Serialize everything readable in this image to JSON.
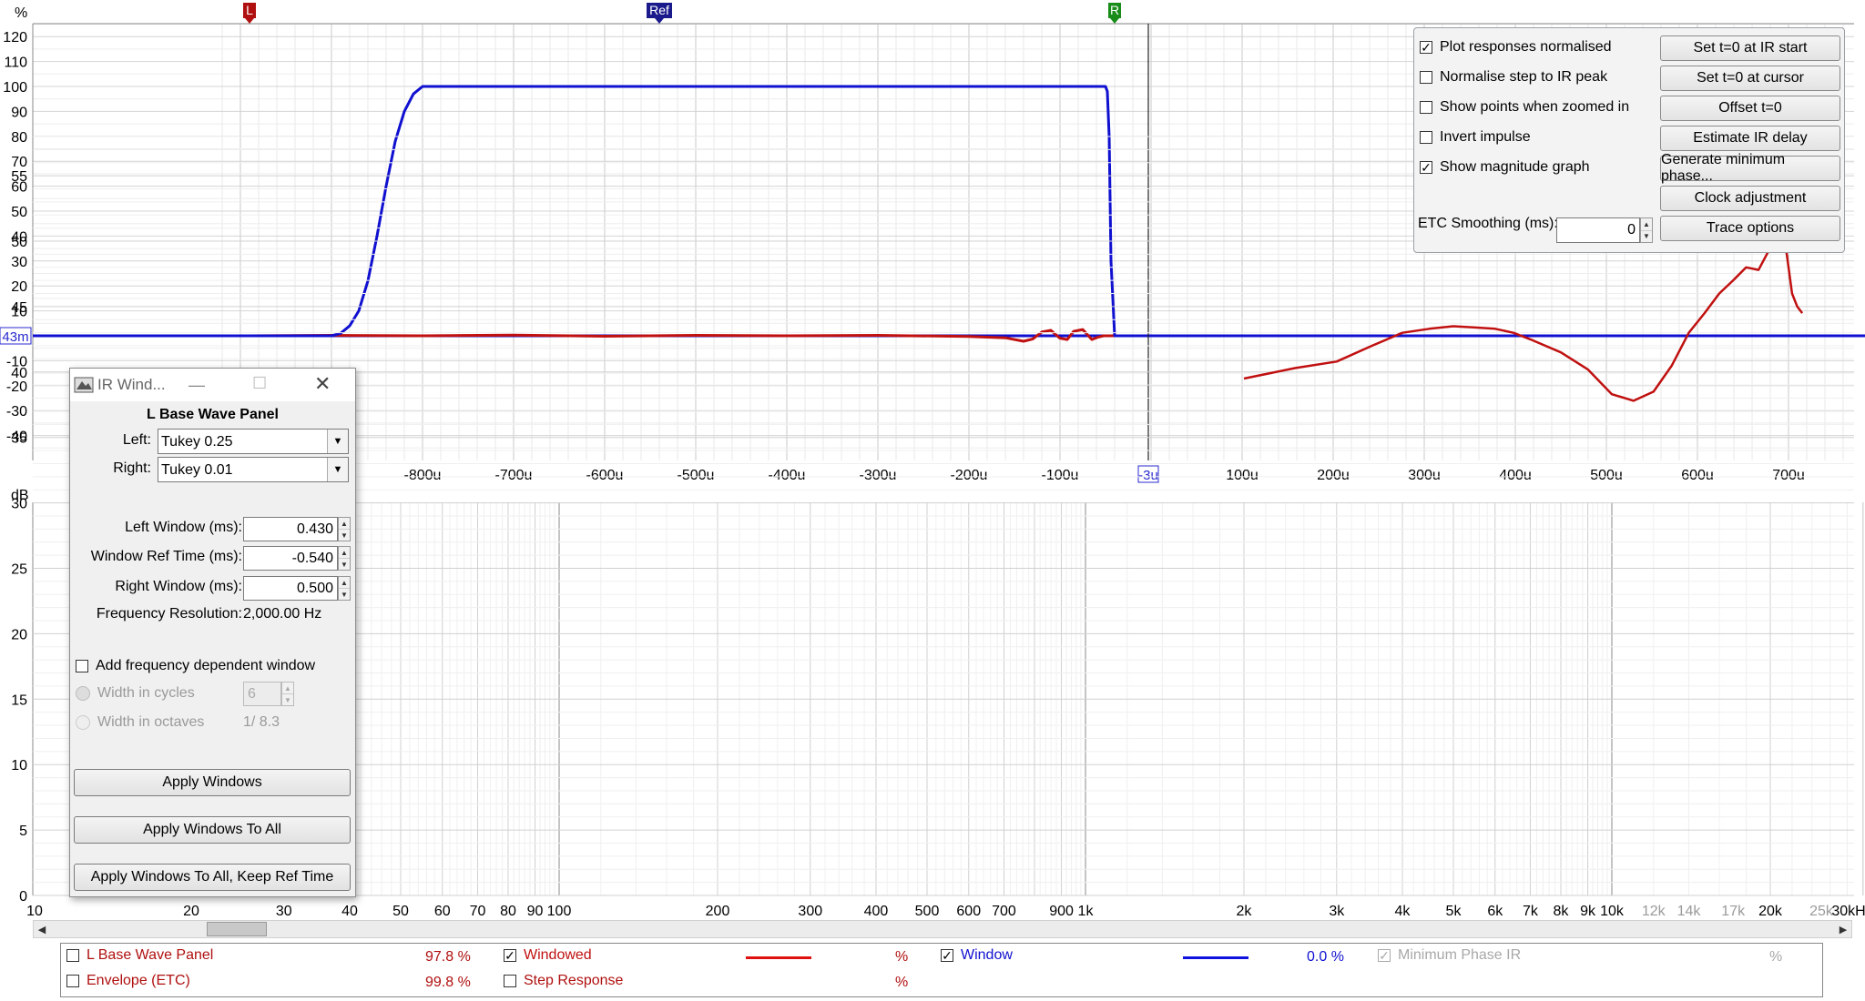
{
  "upper_axis": {
    "unit": "%",
    "y_ticks": [
      "120",
      "110",
      "100",
      "90",
      "80",
      "70",
      "60",
      "50",
      "40",
      "30",
      "20",
      "10",
      "0",
      "-10",
      "-20",
      "-30",
      "-40"
    ],
    "y_values": [
      120,
      110,
      100,
      90,
      80,
      70,
      60,
      50,
      40,
      30,
      20,
      10,
      0,
      -10,
      -20,
      -30,
      -40
    ],
    "zero_marker_label": "43m",
    "x_ticks": [
      "-800u",
      "-700u",
      "-600u",
      "-500u",
      "-400u",
      "-300u",
      "-200u",
      "-100u",
      "100u",
      "200u",
      "300u",
      "400u",
      "500u",
      "600u",
      "700u"
    ],
    "x_values_us": [
      -800,
      -700,
      -600,
      -500,
      -400,
      -300,
      -200,
      -100,
      100,
      200,
      300,
      400,
      500,
      600,
      700
    ],
    "cursor_label": "-3u",
    "markers": [
      {
        "label": "L",
        "color": "#b01010",
        "time_us": -990
      },
      {
        "label": "Ref",
        "color": "#1a1a8c",
        "time_us": -540
      },
      {
        "label": "R",
        "color": "#1a8c1a",
        "time_us": -40
      }
    ]
  },
  "lower_axis": {
    "unit": "dB",
    "y_ticks": [
      "55",
      "50",
      "45",
      "40",
      "35",
      "30",
      "25",
      "20",
      "15",
      "10",
      "5",
      "0"
    ],
    "y_values": [
      55,
      50,
      45,
      40,
      35,
      30,
      25,
      20,
      15,
      10,
      5,
      0
    ],
    "x_ticks": [
      "10",
      "20",
      "30",
      "40",
      "50",
      "60",
      "70",
      "80",
      "90",
      "100",
      "200",
      "300",
      "400",
      "500",
      "600",
      "700",
      "900",
      "1k",
      "2k",
      "3k",
      "4k",
      "5k",
      "6k",
      "7k",
      "8k",
      "9k",
      "10k",
      "12k",
      "14k",
      "17k",
      "20k",
      "25k",
      "30kHz"
    ],
    "x_values_hz": [
      10,
      20,
      30,
      40,
      50,
      60,
      70,
      80,
      90,
      100,
      200,
      300,
      400,
      500,
      600,
      700,
      900,
      1000,
      2000,
      3000,
      4000,
      5000,
      6000,
      7000,
      8000,
      9000,
      10000,
      12000,
      14000,
      17000,
      20000,
      25000,
      30000
    ],
    "dim_ticks": [
      "12k",
      "14k",
      "17k",
      "25k"
    ]
  },
  "chart_data": [
    {
      "type": "line",
      "title": "",
      "xlabel": "",
      "ylabel": "%",
      "ylim": [
        -45,
        125
      ],
      "xlim_us": [
        -1000,
        800
      ],
      "series": [
        {
          "name": "Window",
          "color": "#1010d0",
          "x": [
            -1010,
            -1000,
            -990,
            -980,
            -970,
            -960,
            -950,
            -940,
            -930,
            -920,
            -910,
            -900,
            -890,
            -880,
            -870,
            -860,
            -850,
            -840,
            -830,
            -820,
            -810,
            -800,
            -700,
            -600,
            -500,
            -400,
            -300,
            -200,
            -100,
            -52,
            -50,
            -48,
            -46,
            -44,
            -40,
            -3,
            800
          ],
          "y": [
            0,
            0,
            0,
            0,
            0,
            0,
            0,
            0,
            0,
            0,
            0,
            0,
            1,
            4,
            10,
            22,
            40,
            60,
            78,
            90,
            97,
            100,
            100,
            100,
            100,
            100,
            100,
            100,
            100,
            100,
            100,
            98,
            80,
            30,
            0,
            0,
            0
          ]
        },
        {
          "name": "Windowed",
          "color": "#c01010",
          "x": [
            -990,
            -900,
            -800,
            -700,
            -600,
            -500,
            -400,
            -300,
            -200,
            -160,
            -140,
            -130,
            -120,
            -110,
            -100,
            -92,
            -85,
            -75,
            -65,
            -58,
            -52,
            -46,
            -40
          ],
          "y": [
            0,
            0.2,
            0,
            0.3,
            -0.2,
            0.2,
            0,
            0.2,
            -0.3,
            -0.8,
            -2.2,
            -1.3,
            1.5,
            2.2,
            -1,
            -1.5,
            1.8,
            2.5,
            -1.5,
            -0.5,
            0,
            0,
            0
          ]
        }
      ]
    },
    {
      "type": "line",
      "title": "",
      "xlabel": "",
      "ylabel": "dB",
      "ylim": [
        0,
        58
      ],
      "xlim_hz": [
        10,
        30000
      ],
      "log_x": true,
      "series": [
        {
          "name": "L Base Wave Panel",
          "color": "#c01010",
          "x": [
            2000,
            2500,
            3000,
            3500,
            4000,
            4500,
            5000,
            5500,
            6000,
            6500,
            7000,
            8000,
            9000,
            10000,
            11000,
            12000,
            13000,
            14000,
            15000,
            16000,
            17000,
            18000,
            19000,
            20000,
            21000,
            21500,
            22000,
            22500,
            23000
          ],
          "y": [
            39.5,
            40.3,
            40.8,
            42,
            43,
            43.3,
            43.5,
            43.4,
            43.3,
            43,
            42.5,
            41.5,
            40.2,
            38.3,
            37.8,
            38.5,
            40.5,
            43,
            44.5,
            46,
            47,
            48,
            47.8,
            49.5,
            51,
            49,
            46,
            45,
            44.5
          ]
        }
      ]
    }
  ],
  "options_panel": {
    "checkboxes": [
      {
        "label": "Plot responses normalised",
        "checked": "✓"
      },
      {
        "label": "Normalise step to IR peak",
        "checked": ""
      },
      {
        "label": "Show points when zoomed in",
        "checked": ""
      },
      {
        "label": "Invert impulse",
        "checked": ""
      },
      {
        "label": "Show magnitude graph",
        "checked": "✓"
      }
    ],
    "buttons": [
      "Set t=0 at IR start",
      "Set t=0 at cursor",
      "Offset t=0",
      "Estimate IR delay",
      "Generate minimum phase...",
      "Clock adjustment",
      "Trace options"
    ],
    "etc_label": "ETC Smoothing (ms):",
    "etc_value": "0"
  },
  "dialog": {
    "title": "IR Wind...",
    "heading": "L Base Wave Panel",
    "left_label": "Left:",
    "left_value": "Tukey 0.25",
    "right_label": "Right:",
    "right_value": "Tukey 0.01",
    "left_window_label": "Left Window (ms):",
    "left_window_value": "0.430",
    "ref_time_label": "Window Ref Time (ms):",
    "ref_time_value": "-0.540",
    "right_window_label": "Right Window (ms):",
    "right_window_value": "0.500",
    "freq_res_label": "Frequency Resolution:",
    "freq_res_value": "2,000.00 Hz",
    "fdw_label": "Add frequency dependent window",
    "cycles_label": "Width in cycles",
    "cycles_value": "6",
    "octaves_label": "Width in octaves",
    "octaves_value": "1/ 8.3",
    "apply": "Apply Windows",
    "apply_all": "Apply Windows To All",
    "apply_all_keep": "Apply Windows To All, Keep Ref Time"
  },
  "legend": {
    "row1": [
      {
        "label": "L Base Wave Panel",
        "value": "97.8 %",
        "color": "#b01010",
        "checked": ""
      },
      {
        "label": "Windowed",
        "value": "%",
        "color": "#c01010",
        "checked": "✓"
      },
      {
        "label": "Window",
        "value": "0.0 %",
        "color": "#1010d0",
        "checked": "✓"
      },
      {
        "label": "Minimum Phase IR",
        "value": "%",
        "color": "#a8a8a8",
        "checked": "✓"
      }
    ],
    "row2": [
      {
        "label": "Envelope (ETC)",
        "value": "99.8 %",
        "color": "#b01010",
        "checked": ""
      },
      {
        "label": "Step Response",
        "value": "%",
        "color": "#b01010",
        "checked": ""
      }
    ]
  }
}
